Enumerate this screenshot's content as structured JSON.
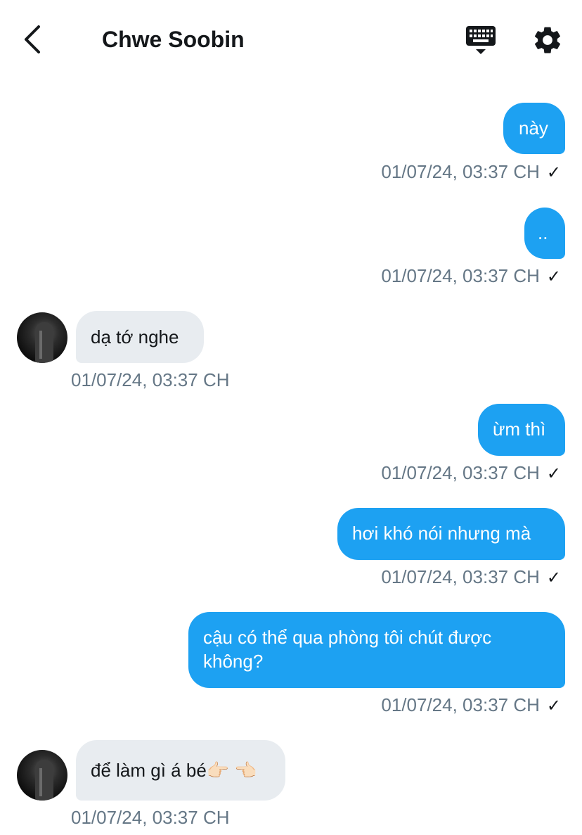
{
  "header": {
    "title": "Chwe Soobin",
    "icons": [
      "back-icon",
      "keyboard-icon",
      "settings-icon"
    ]
  },
  "messages": [
    {
      "direction": "outgoing",
      "text": "này",
      "time": "01/07/24, 03:37 CH",
      "status": "✓"
    },
    {
      "direction": "outgoing",
      "text": "..",
      "time": "01/07/24, 03:37 CH",
      "status": "✓"
    },
    {
      "direction": "incoming",
      "text": "dạ tớ nghe",
      "time": "01/07/24, 03:37 CH"
    },
    {
      "direction": "outgoing",
      "text": "ừm thì",
      "time": "01/07/24, 03:37 CH",
      "status": "✓"
    },
    {
      "direction": "outgoing",
      "text": "hơi khó nói nhưng mà",
      "time": "01/07/24, 03:37 CH",
      "status": "✓"
    },
    {
      "direction": "outgoing",
      "text": "cậu có thể qua phòng tôi chút được không?",
      "time": "01/07/24, 03:37 CH",
      "status": "✓"
    },
    {
      "direction": "incoming",
      "text": "để làm gì á bé👉🏻 👈🏻",
      "time": "01/07/24, 03:37 CH"
    }
  ],
  "colors": {
    "outgoing_bubble": "#1da1f2",
    "incoming_bubble": "#e8ecf0",
    "timestamp": "#657786",
    "text_dark": "#14171a"
  }
}
